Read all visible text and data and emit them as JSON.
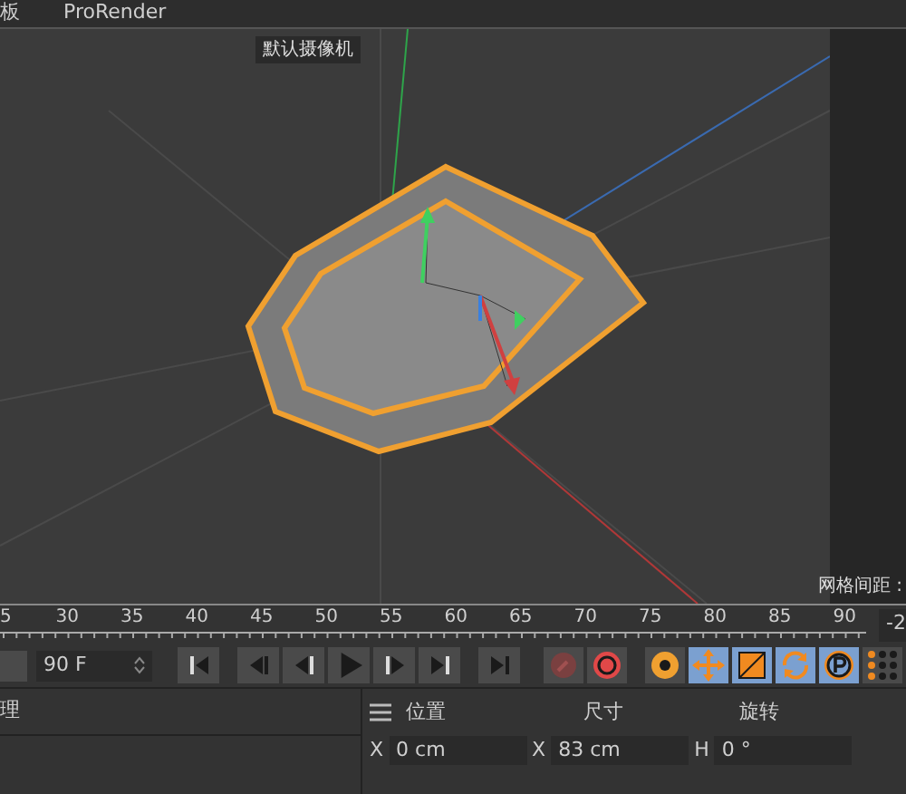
{
  "menu": [
    "板",
    "ProRender"
  ],
  "viewport": {
    "camera_label": "默认摄像机",
    "grid_spacing_label": "网格间距 :"
  },
  "timeline": {
    "ticks": [
      "5",
      "30",
      "35",
      "40",
      "45",
      "50",
      "55",
      "60",
      "65",
      "70",
      "75",
      "80",
      "85",
      "90"
    ],
    "end_field": "-2"
  },
  "transport": {
    "frame_field": "90 F",
    "buttons": [
      {
        "kind": "first"
      },
      {
        "kind": "prevkey"
      },
      {
        "kind": "prev"
      },
      {
        "kind": "play"
      },
      {
        "kind": "next"
      },
      {
        "kind": "nextkey"
      },
      {
        "kind": "last"
      }
    ],
    "tools": [
      {
        "kind": "record",
        "selected": false
      },
      {
        "kind": "autokey",
        "selected": false
      },
      {
        "kind": "keygear",
        "selected": false
      },
      {
        "kind": "move",
        "selected": true
      },
      {
        "kind": "scale",
        "selected": true
      },
      {
        "kind": "rotate",
        "selected": true
      },
      {
        "kind": "param",
        "selected": true
      },
      {
        "kind": "dots",
        "selected": false
      }
    ]
  },
  "left_panel": {
    "title": "理"
  },
  "coords": {
    "headers": [
      "位置",
      "尺寸",
      "旋转"
    ],
    "fields": [
      {
        "axis": "X",
        "value": "0 cm"
      },
      {
        "axis": "X",
        "value": "83 cm"
      },
      {
        "axis": "H",
        "value": "0 °"
      }
    ]
  }
}
